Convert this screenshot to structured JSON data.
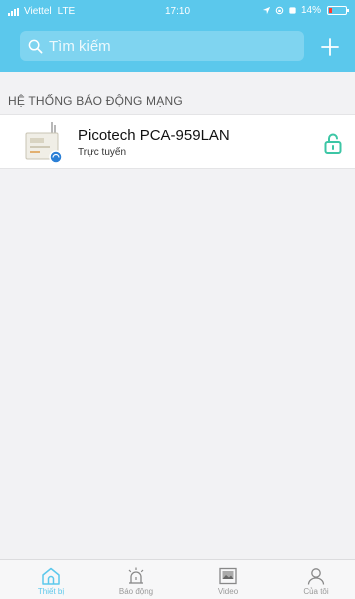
{
  "status_bar": {
    "carrier": "Viettel",
    "network": "LTE",
    "time": "17:10",
    "battery": "14%"
  },
  "search": {
    "placeholder": "Tìm kiếm"
  },
  "section": {
    "title": "HỆ THỐNG BÁO ĐỘNG MẠNG"
  },
  "devices": [
    {
      "name": "Picotech PCA-959LAN",
      "status": "Trực tuyến",
      "lock_icon": "unlock-icon"
    }
  ],
  "tabs": [
    {
      "label": "Thiết bị",
      "icon": "home-icon",
      "active": true
    },
    {
      "label": "Báo động",
      "icon": "alarm-siren-icon",
      "active": false
    },
    {
      "label": "Video",
      "icon": "image-icon",
      "active": false
    },
    {
      "label": "Của tôi",
      "icon": "user-icon",
      "active": false
    }
  ],
  "colors": {
    "accent": "#5bc8ec",
    "background": "#f2f2f4",
    "battery_low": "#ff3b30"
  }
}
